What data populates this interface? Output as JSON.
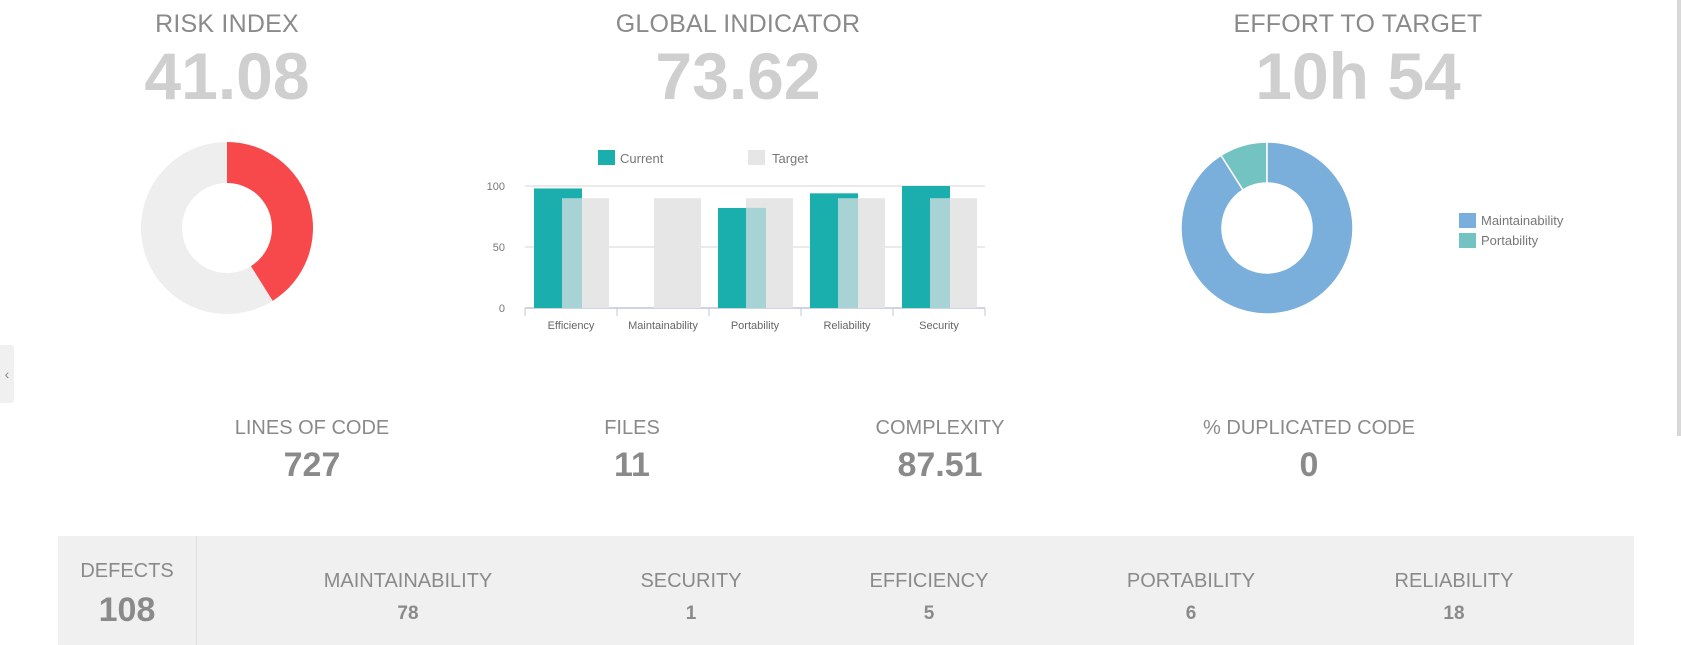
{
  "kpis": {
    "risk_index": {
      "title": "RISK INDEX",
      "value": "41.08"
    },
    "global_indicator": {
      "title": "GLOBAL INDICATOR",
      "value": "73.62"
    },
    "effort_to_target": {
      "title": "EFFORT TO TARGET",
      "value": "10h 54"
    }
  },
  "risk_donut": {
    "value": 41.08,
    "max": 100,
    "colors": {
      "filled": "#f7494b",
      "rest": "#eeeeee"
    }
  },
  "chart_data": [
    {
      "type": "bar",
      "categories": [
        "Efficiency",
        "Maintainability",
        "Portability",
        "Reliability",
        "Security"
      ],
      "series": [
        {
          "name": "Current",
          "values": [
            98,
            0,
            82,
            94,
            100
          ],
          "color": "#1aaeac"
        },
        {
          "name": "Target",
          "values": [
            90,
            90,
            90,
            90,
            90
          ],
          "color": "#e6e6e6",
          "overlap_color": "#a8d3d5"
        }
      ],
      "ylim": [
        0,
        100
      ],
      "yticks": [
        "0",
        "50",
        "100"
      ],
      "grid": true,
      "legend": "top"
    },
    {
      "type": "pie",
      "labels": [
        "Maintainability",
        "Portability"
      ],
      "values": [
        91,
        9
      ],
      "colors": [
        "#7aaedb",
        "#74c3c3"
      ],
      "legend": "right"
    }
  ],
  "metrics": [
    {
      "title": "LINES OF CODE",
      "value": "727"
    },
    {
      "title": "FILES",
      "value": "11"
    },
    {
      "title": "COMPLEXITY",
      "value": "87.51"
    },
    {
      "title": "% DUPLICATED CODE",
      "value": "0"
    }
  ],
  "defects": {
    "total_label": "DEFECTS",
    "total_value": "108",
    "categories": [
      {
        "label": "MAINTAINABILITY",
        "value": "78"
      },
      {
        "label": "SECURITY",
        "value": "1"
      },
      {
        "label": "EFFICIENCY",
        "value": "5"
      },
      {
        "label": "PORTABILITY",
        "value": "6"
      },
      {
        "label": "RELIABILITY",
        "value": "18"
      }
    ]
  },
  "icons": {
    "side_tab": "chevron-left-icon"
  }
}
